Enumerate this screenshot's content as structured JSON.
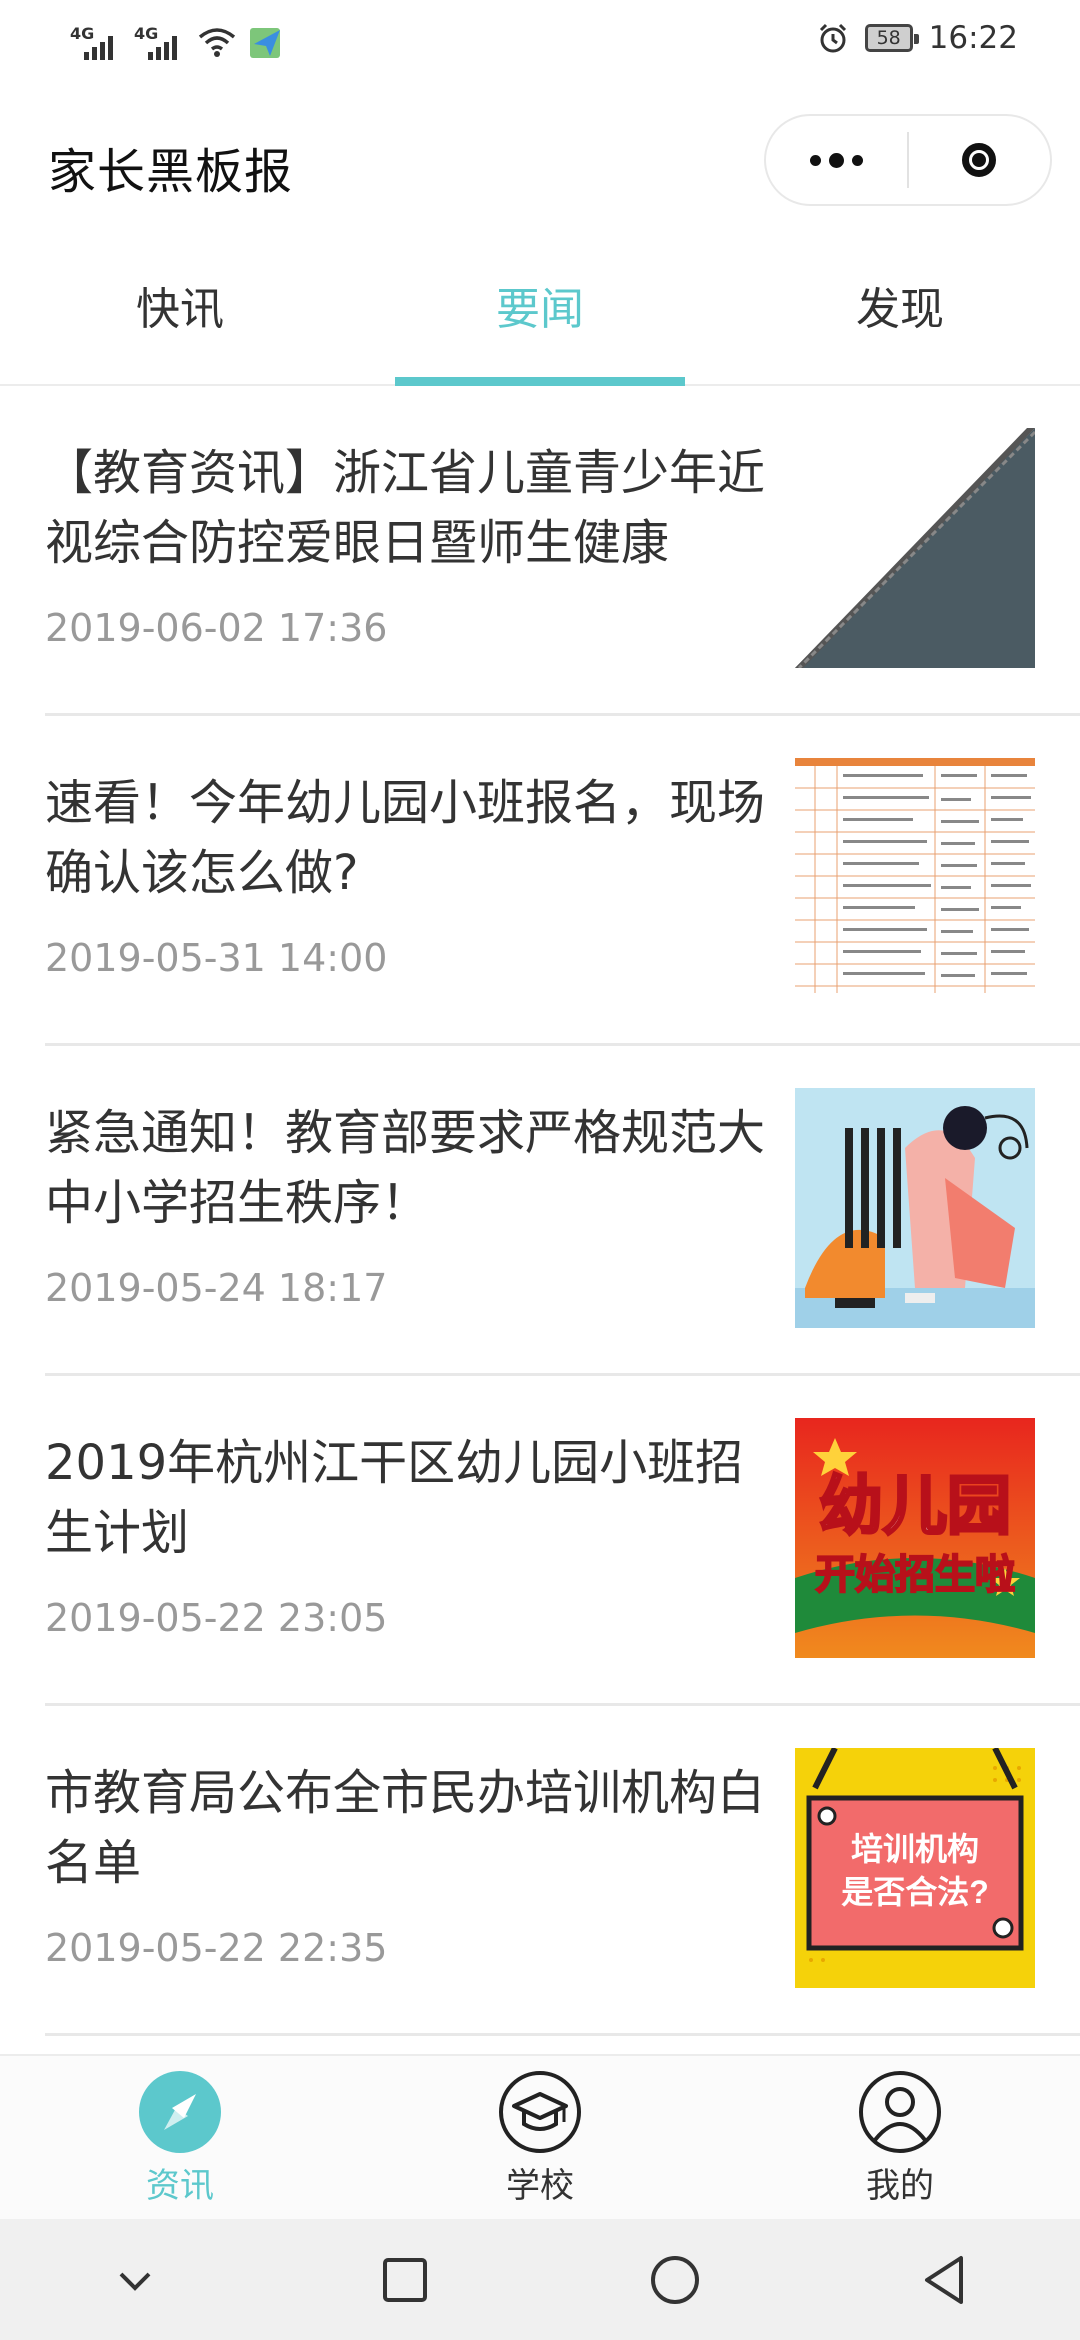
{
  "status_bar": {
    "signal1_label": "4G",
    "signal2_label": "4G",
    "battery": "58",
    "time": "16:22",
    "icons": [
      "signal-icon",
      "signal-icon",
      "wifi-icon",
      "airplane-icon",
      "alarm-icon",
      "battery-icon"
    ]
  },
  "header": {
    "title": "家长黑板报",
    "more_icon": "more-dots-icon",
    "close_icon": "target-close-icon"
  },
  "tabs": [
    {
      "label": "快讯",
      "active": false
    },
    {
      "label": "要闻",
      "active": true
    },
    {
      "label": "发现",
      "active": false
    }
  ],
  "news": [
    {
      "title": "【教育资讯】浙江省儿童青少年近视综合防控爱眼日暨师生健康",
      "date": "2019-06-02 17:36",
      "thumb": "diagonal-gray-image"
    },
    {
      "title": "速看！今年幼儿园小班报名，现场确认该怎么做?",
      "date": "2019-05-31 14:00",
      "thumb": "schedule-table-image"
    },
    {
      "title": "紧急通知！教育部要求严格规范大中小学招生秩序！",
      "date": "2019-05-24 18:17",
      "thumb": "illustration-image"
    },
    {
      "title": "2019年杭州江干区幼儿园小班招生计划",
      "date": "2019-05-22 23:05",
      "thumb": "kindergarten-poster-image"
    },
    {
      "title": "市教育局公布全市民办培训机构白名单",
      "date": "2019-05-22 22:35",
      "thumb": "training-sign-image"
    }
  ],
  "thumb_text": {
    "poster_line1": "幼儿园",
    "poster_line2": "开始招生啦",
    "sign_line1": "培训机构",
    "sign_line2": "是否合法?"
  },
  "tabbar": [
    {
      "label": "资讯",
      "icon": "compass-icon",
      "active": true
    },
    {
      "label": "学校",
      "icon": "graduation-cap-icon",
      "active": false
    },
    {
      "label": "我的",
      "icon": "user-icon",
      "active": false
    }
  ],
  "colors": {
    "accent": "#5cc8cc",
    "text": "#333333",
    "subtext": "#999999"
  }
}
